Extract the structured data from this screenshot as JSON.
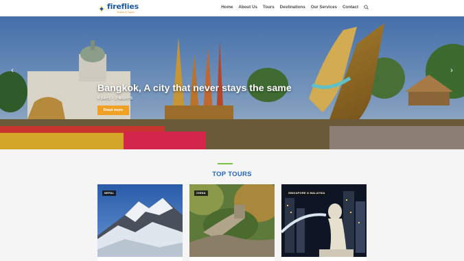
{
  "header": {
    "logo_name": "fireflies",
    "logo_tagline": "Travel & Tours",
    "nav": [
      "Home",
      "About Us",
      "Tours",
      "Destinations",
      "Our Services",
      "Contact"
    ],
    "search_icon": "search-icon"
  },
  "hero": {
    "title": "Bangkok, A city that never stays the same",
    "subtitle": "4 DAYS – 3 NIGHTS",
    "button_label": "Read more",
    "prev_icon": "chevron-left-icon",
    "next_icon": "chevron-right-icon"
  },
  "section": {
    "title": "TOP TOURS",
    "accent_color": "#7cc142",
    "title_color": "#1f64b2"
  },
  "tours": [
    {
      "tag": "NEPAL"
    },
    {
      "tag": "CHINA"
    },
    {
      "tag": "SINGAPORE & MALAYSIA"
    }
  ],
  "colors": {
    "brand": "#1b5a9e",
    "button": "#f0a024"
  }
}
